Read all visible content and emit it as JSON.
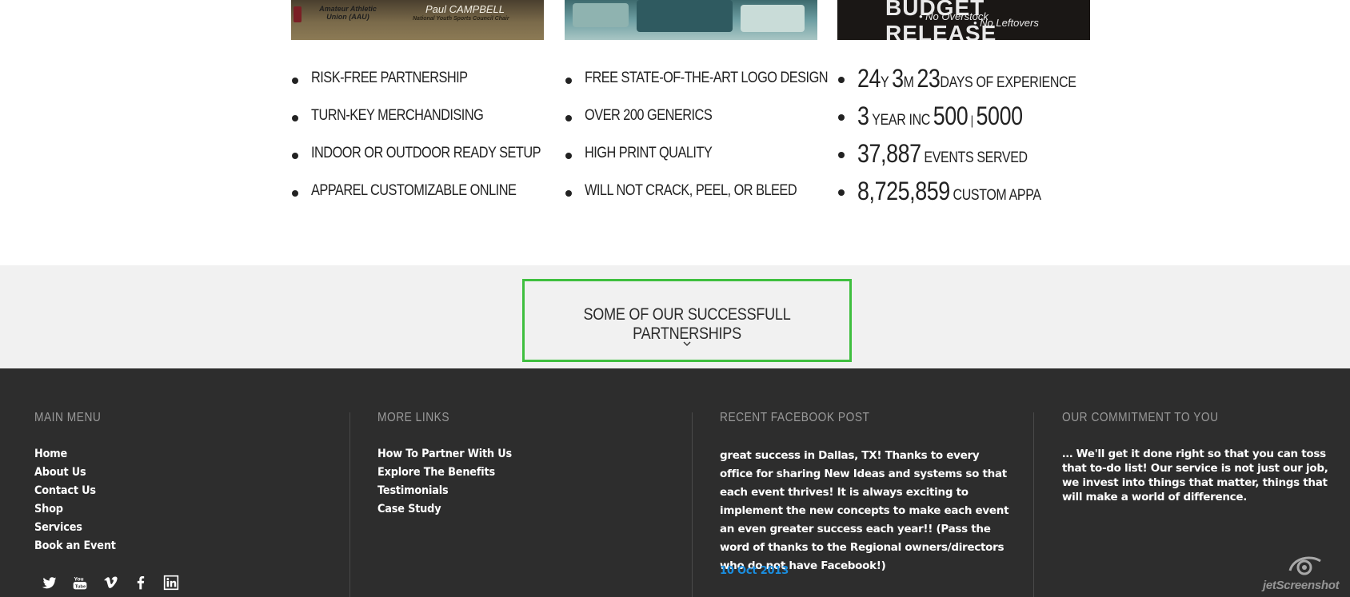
{
  "features": {
    "images": [
      {
        "aria": "Paul Campbell AAU photo",
        "org_text": "Amateur Athletic Union (AAU)",
        "name_text": "Paul CAMPBELL",
        "title_text": "National Youth Sports Council Chair"
      },
      {
        "aria": "Merchandise table photo"
      },
      {
        "aria": "Budget release banner",
        "headline": "BUDGET RELEASE",
        "tag1": "• No Overstock",
        "tag2": "• No Leftovers"
      }
    ],
    "col1": [
      "RISK-FREE PARTNERSHIP",
      "TURN-KEY MERCHANDISING",
      "INDOOR OR OUTDOOR READY SETUP",
      "APPAREL CUSTOMIZABLE ONLINE"
    ],
    "col2": [
      "FREE STATE-OF-THE-ART LOGO DESIGN",
      "OVER 200 GENERICS",
      "HIGH PRINT QUALITY",
      "WILL NOT CRACK, PEEL, OR BLEED"
    ],
    "stats": {
      "experience": {
        "years": "24",
        "y_unit": "Y",
        "months": "3",
        "m_unit": "M",
        "days": "23",
        "label": "DAYS OF EXPERIENCE"
      },
      "inc": {
        "count": "3",
        "label": "YEAR INC",
        "n1": "500",
        "sep": "|",
        "n2": "5000"
      },
      "events": {
        "count": "37,887",
        "label": "EVENTS SERVED"
      },
      "apparel": {
        "count": "8,725,859",
        "label": "CUSTOM APPA"
      }
    }
  },
  "partnerships": {
    "label": "SOME OF OUR SUCCESSFULL PARTNERSHIPS"
  },
  "footer": {
    "main_menu": {
      "heading": "MAIN MENU",
      "items": [
        "Home",
        "About Us",
        "Contact Us",
        "Shop",
        "Services",
        "Book an Event"
      ]
    },
    "more_links": {
      "heading": "MORE LINKS",
      "items": [
        "How To Partner With Us",
        "Explore The Benefits",
        "Testimonials",
        "Case Study"
      ]
    },
    "facebook": {
      "heading": "RECENT FACEBOOK POST",
      "post": "great success in Dallas, TX! Thanks to every office for sharing New Ideas and systems so that each event thrives! It is always exciting to implement the new concepts to make each event an even greater success each year!! (Pass the word of thanks to the Regional owners/directors who do not have Facebook!)",
      "date": "10 Oct 2013"
    },
    "commitment": {
      "heading": "OUR COMMITMENT TO YOU",
      "text": "… We'll get it done right so that you can toss that to-do list! Our service is not just our job, we invest into things that matter, things that will make a world of difference."
    },
    "socials": [
      "twitter-icon",
      "youtube-icon",
      "vimeo-icon",
      "facebook-icon",
      "linkedin-icon"
    ],
    "colors": {
      "background": "#2d2d2d",
      "date": "#1a8ee0",
      "heading": "#9a9a9a",
      "partner_border": "#3fbf3f"
    }
  },
  "watermark": {
    "text": "jetScreenshot"
  }
}
